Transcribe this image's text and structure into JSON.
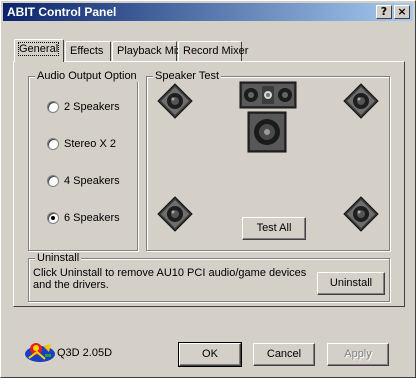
{
  "window": {
    "title": "ABIT Control Panel"
  },
  "titlebar": {
    "help_label": "?",
    "close_label": "×"
  },
  "tabs": [
    {
      "label": "General",
      "active": true
    },
    {
      "label": "Effects",
      "active": false
    },
    {
      "label": "Playback Mixer",
      "active": false
    },
    {
      "label": "Record Mixer",
      "active": false
    }
  ],
  "audio_output": {
    "label": "Audio Output Option",
    "options": [
      {
        "label": "2 Speakers",
        "selected": false
      },
      {
        "label": "Stereo X 2",
        "selected": false
      },
      {
        "label": "4 Speakers",
        "selected": false
      },
      {
        "label": "6 Speakers",
        "selected": true
      }
    ]
  },
  "speaker_test": {
    "label": "Speaker Test",
    "test_all_label": "Test All",
    "speakers": [
      "front-left-speaker-icon",
      "center-speaker-icon",
      "front-right-speaker-icon",
      "subwoofer-icon",
      "rear-left-speaker-icon",
      "rear-right-speaker-icon"
    ]
  },
  "uninstall": {
    "label": "Uninstall",
    "description": "Click Uninstall to remove AU10 PCI audio/game devices and the drivers.",
    "button_label": "Uninstall"
  },
  "footer": {
    "version": "Q3D 2.05D",
    "ok_label": "OK",
    "cancel_label": "Cancel",
    "apply_label": "Apply"
  },
  "colors": {
    "titlebar_start": "#0a246a",
    "titlebar_end": "#a6caf0",
    "face": "#d4d0c8"
  }
}
